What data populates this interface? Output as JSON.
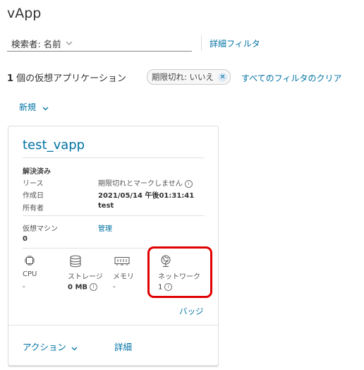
{
  "page": {
    "title": "vApp"
  },
  "filter": {
    "search_label": "検索者: 名前",
    "advanced_filter": "詳細フィルタ"
  },
  "results": {
    "count": "1",
    "count_suffix": " 個の仮想アプリケーション",
    "chip_label": "期限切れ: いいえ",
    "clear_filters": "すべてのフィルタのクリア"
  },
  "toolbar": {
    "new_label": "新規"
  },
  "card": {
    "title": "test_vapp",
    "status": "解決済み",
    "lease_key": "リース",
    "lease_value": "期限切れとマークしません",
    "created_key": "作成日",
    "created_value": "2021/05/14 午後01:31:41",
    "owner_key": "所有者",
    "owner_value": "test",
    "vm_key": "仮想マシン",
    "vm_manage": "管理",
    "vm_count": "0",
    "resources": {
      "cpu_label": "CPU",
      "cpu_value": "-",
      "storage_label": "ストレージ",
      "storage_value": "0 MB",
      "memory_label": "メモリ",
      "memory_value": "-",
      "network_label": "ネットワーク",
      "network_value": "1"
    },
    "badge_link": "バッジ",
    "actions_label": "アクション",
    "details_label": "詳細"
  },
  "colors": {
    "link": "#0072a3",
    "highlight": "#e00000"
  }
}
